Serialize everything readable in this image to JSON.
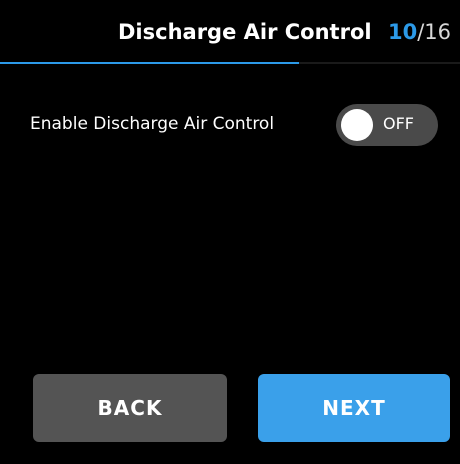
{
  "header": {
    "title": "Discharge Air Control",
    "step_current": "10",
    "step_total": "/16",
    "progress": 0.65,
    "accent_color": "#2c9ae8"
  },
  "setting": {
    "label": "Enable Discharge Air Control",
    "toggle_state": "OFF"
  },
  "buttons": {
    "back_label": "BACK",
    "next_label": "NEXT"
  }
}
